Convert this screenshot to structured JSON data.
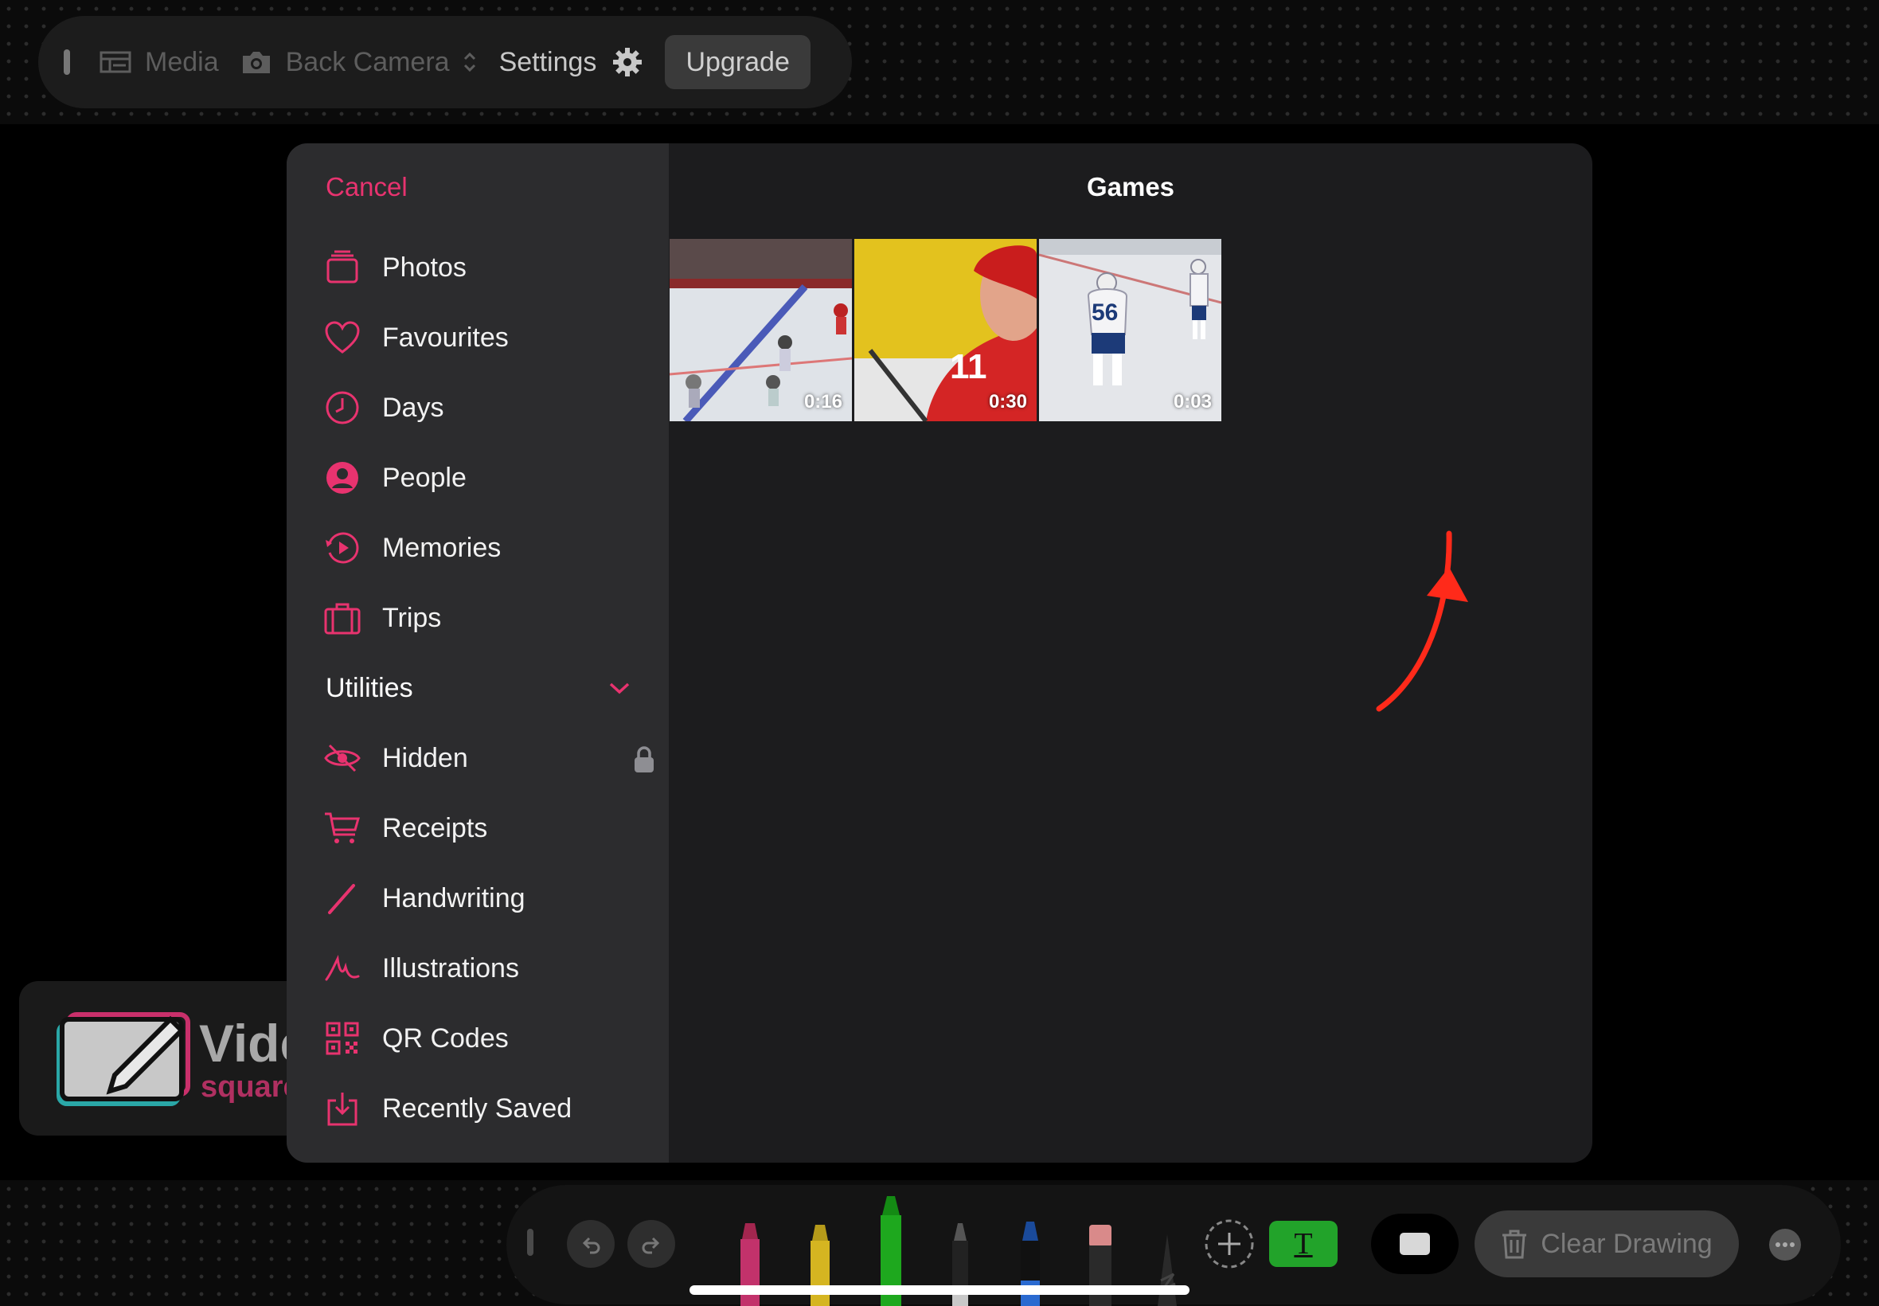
{
  "top_bar": {
    "media_label": "Media",
    "camera_label": "Back Camera",
    "settings_label": "Settings",
    "upgrade_label": "Upgrade"
  },
  "background_card": {
    "title": "Vide",
    "subtitle": "square"
  },
  "picker": {
    "cancel_label": "Cancel",
    "album_title": "Games",
    "nav_items": [
      {
        "label": "Photos",
        "icon": "photos-stack-icon"
      },
      {
        "label": "Favourites",
        "icon": "heart-icon"
      },
      {
        "label": "Days",
        "icon": "clock-icon"
      },
      {
        "label": "People",
        "icon": "person-circle-icon"
      },
      {
        "label": "Memories",
        "icon": "memories-play-icon"
      },
      {
        "label": "Trips",
        "icon": "suitcase-icon"
      }
    ],
    "utilities_label": "Utilities",
    "utility_items": [
      {
        "label": "Hidden",
        "icon": "eye-slash-icon"
      },
      {
        "label": "Receipts",
        "icon": "cart-icon"
      },
      {
        "label": "Handwriting",
        "icon": "pencil-line-icon"
      },
      {
        "label": "Illustrations",
        "icon": "scribble-icon"
      },
      {
        "label": "QR Codes",
        "icon": "qr-code-icon"
      },
      {
        "label": "Recently Saved",
        "icon": "download-tray-icon"
      }
    ],
    "thumbnails": [
      {
        "duration": "0:16"
      },
      {
        "duration": "0:30"
      },
      {
        "duration": "0:03"
      }
    ]
  },
  "toolbar": {
    "clear_label": "Clear Drawing",
    "text_tool_glyph": "T"
  },
  "colors": {
    "accent": "#e8336f",
    "annotation_arrow": "#ff2a1a",
    "text_tool": "#22a32a"
  }
}
